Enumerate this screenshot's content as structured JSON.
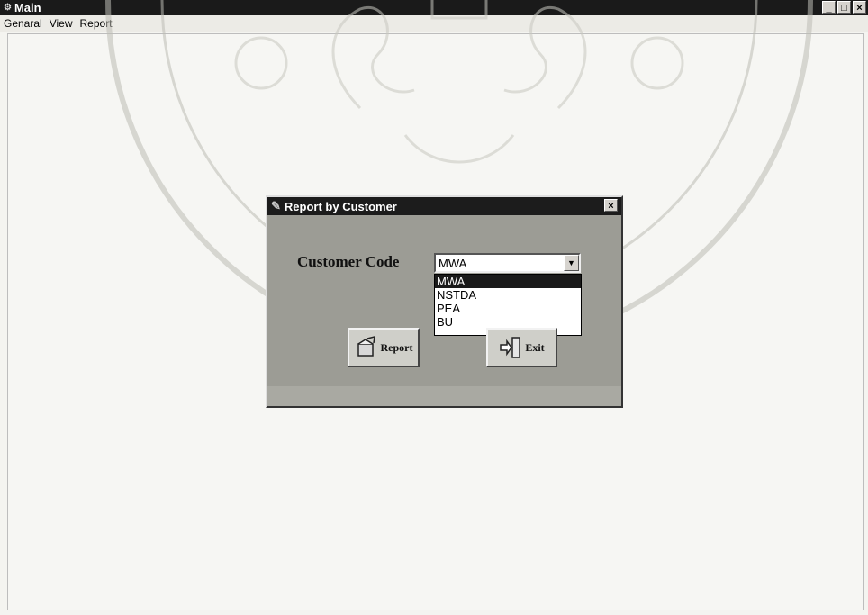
{
  "window": {
    "title": "Main",
    "buttons": [
      "_",
      "□",
      "×"
    ]
  },
  "menu": {
    "items": [
      "Genaral",
      "View",
      "Report"
    ]
  },
  "dialog": {
    "title": "Report by Customer",
    "close": "×",
    "customer_label": "Customer Code",
    "combo": {
      "value": "MWA",
      "options": [
        "MWA",
        "NSTDA",
        "PEA",
        "BU"
      ],
      "selected_index": 0,
      "expanded": true
    },
    "report_button": "Report",
    "exit_button": "Exit"
  },
  "icons": [
    "app-icon",
    "minimize-icon",
    "maximize-icon",
    "close-icon",
    "dialog-icon",
    "dropdown-arrow-icon",
    "report-icon",
    "exit-icon",
    "seal-watermark"
  ],
  "colors": {
    "titlebar": "#1a1a1a",
    "dialog_bg": "#9c9c95",
    "selection": "#1a1a1a"
  }
}
